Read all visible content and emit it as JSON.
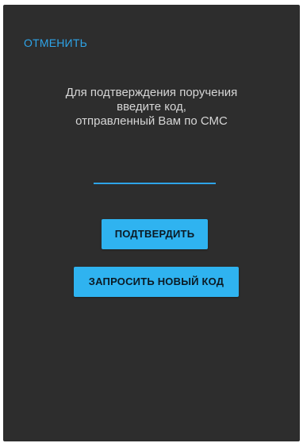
{
  "header": {
    "cancel_label": "ОТМЕНИТЬ"
  },
  "message": {
    "line1": "Для подтверждения поручения",
    "line2": "введите код,",
    "line3": "отправленный Вам по СМС"
  },
  "code_input": {
    "value": "",
    "placeholder": ""
  },
  "buttons": {
    "confirm_label": "ПОДТВЕРДИТЬ",
    "request_new_code_label": "ЗАПРОСИТЬ НОВЫЙ КОД"
  },
  "colors": {
    "background": "#2d2d2d",
    "accent": "#2ea4e8",
    "button": "#2fb3f0"
  }
}
